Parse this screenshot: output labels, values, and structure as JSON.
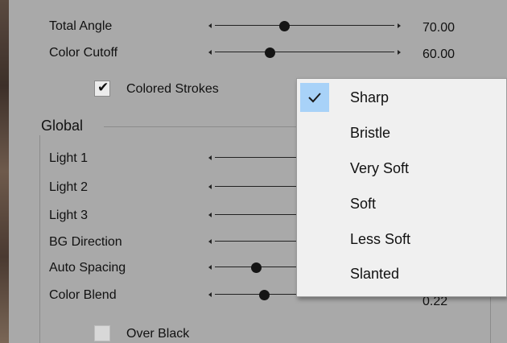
{
  "sliders_top": [
    {
      "label": "Total Angle",
      "value": "70.00",
      "fraction": 0.36
    },
    {
      "label": "Color Cutoff",
      "value": "60.00",
      "fraction": 0.33
    }
  ],
  "colored_strokes": {
    "label": "Colored Strokes",
    "checked": true
  },
  "global": {
    "title": "Global",
    "sliders": [
      {
        "label": "Light 1",
        "value": "",
        "fraction": null
      },
      {
        "label": "Light 2",
        "value": "",
        "fraction": null
      },
      {
        "label": "Light 3",
        "value": "",
        "fraction": null
      },
      {
        "label": "BG Direction",
        "value": "",
        "fraction": null
      },
      {
        "label": "Auto Spacing",
        "value": "",
        "fraction": 0.2
      },
      {
        "label": "Color Blend",
        "value": "0.22",
        "fraction": 0.26
      }
    ],
    "over_black": {
      "label": "Over Black",
      "checked": false
    }
  },
  "brush_menu": {
    "items": [
      {
        "label": "Sharp",
        "checked": true
      },
      {
        "label": "Bristle",
        "checked": false
      },
      {
        "label": "Very Soft",
        "checked": false
      },
      {
        "label": "Soft",
        "checked": false
      },
      {
        "label": "Less Soft",
        "checked": false
      },
      {
        "label": "Slanted",
        "checked": false
      }
    ]
  },
  "colors": {
    "panel": "#a9a9a9",
    "menu_bg": "#f0f0f0",
    "menu_highlight": "#a8d2f8"
  }
}
